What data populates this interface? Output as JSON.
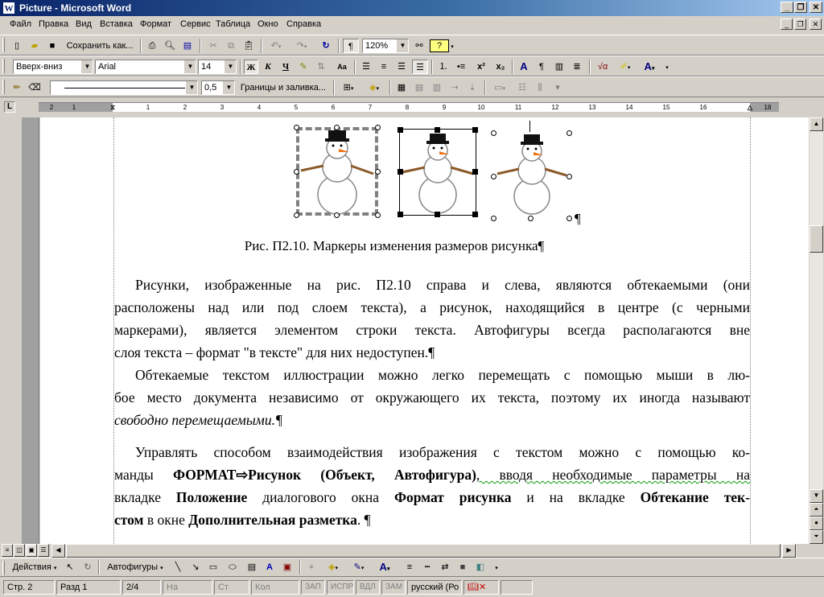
{
  "window": {
    "title": "Picture - Microsoft Word",
    "app_icon": "W",
    "controls": [
      "_",
      "❐",
      "✕"
    ]
  },
  "menu": [
    "Файл",
    "Правка",
    "Вид",
    "Вставка",
    "Формат",
    "Сервис",
    "Таблица",
    "Окно",
    "Справка"
  ],
  "standard_toolbar": {
    "save_as_label": "Сохранить как...",
    "zoom": "120%"
  },
  "formatting_toolbar": {
    "text_direction": "Вверх-вниз",
    "font": "Arial",
    "size": "14",
    "bold": "Ж",
    "italic": "К",
    "underline": "Ч",
    "superscript": "x²",
    "subscript": "x₂"
  },
  "tables_toolbar": {
    "line_weight": "0,5",
    "borders_label": "Границы и заливка..."
  },
  "ruler": {
    "numbers": [
      "2",
      "1",
      "1",
      "2",
      "3",
      "4",
      "5",
      "6",
      "7",
      "8",
      "9",
      "10",
      "11",
      "12",
      "13",
      "14",
      "15",
      "16",
      "17",
      "18"
    ]
  },
  "document": {
    "caption": "Рис. П2.10. Маркеры изменения размеров рисунка¶",
    "para1": [
      "Рисунки, изображенные на рис. П2.10 справа и слева, являются обтекаемыми (они",
      "расположены над или под слоем текста), а рисунок, находящийся в центре (с черными",
      "маркерами), является элементом строки текста. Автофигуры всегда располагаются вне",
      "слоя текста – формат \"в тексте\" для них недоступен.¶"
    ],
    "para2": [
      "Обтекаемые текстом иллюстрации можно легко перемещать с помощью мыши в лю-",
      "бое место документа независимо от окружающего их текста, поэтому их иногда называют",
      "свободно перемещаемыми.¶"
    ],
    "para3": {
      "l1": "Управлять способом взаимодействия изображения с текстом можно с помощью ко-",
      "l2a": "манды ",
      "l2b": "ФОРМАТ⇨Рисунок (Объект, Автофигура)",
      "l2c": ", вводя необходимые параметры на",
      "l3a": "вкладке ",
      "l3b": "Положение",
      "l3c": " диалогового окна ",
      "l3d": "Формат рисунка",
      "l3e": " и на вкладке ",
      "l3f": "Обтекание тек-",
      "l4a": "стом",
      "l4b": " в окне ",
      "l4c": "Дополнительная разметка",
      "l4d": ". ¶"
    },
    "pilcrow": "¶"
  },
  "drawing_toolbar": {
    "actions": "Действия",
    "autoshapes": "Автофигуры"
  },
  "status": {
    "page": "Стр. 2",
    "section": "Разд 1",
    "pages": "2/4",
    "at": "На",
    "line": "Ст",
    "col": "Кол",
    "rec": "ЗАП",
    "trk": "ИСПР",
    "ext": "ВДЛ",
    "ovr": "ЗАМ",
    "lang": "русский (Ро"
  }
}
